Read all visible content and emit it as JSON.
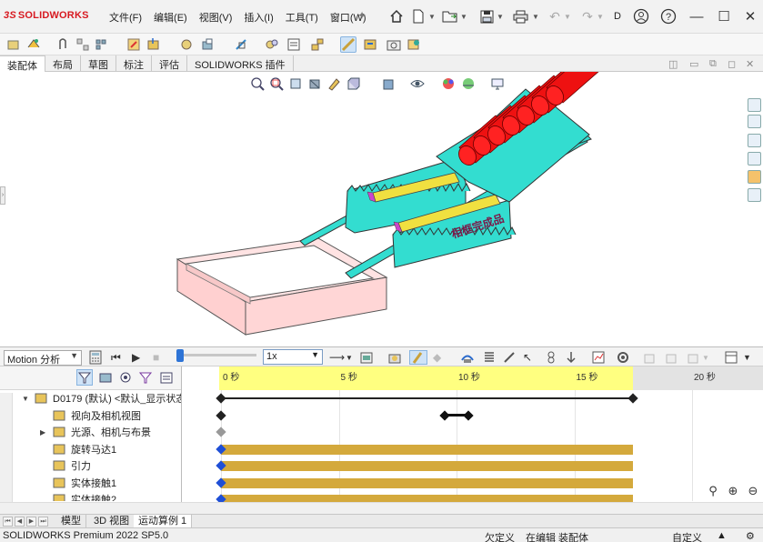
{
  "app": {
    "logo_prefix": "3S",
    "logo_text": "SOLIDWORKS",
    "user_initial": "D"
  },
  "menu": [
    "文件(F)",
    "编辑(E)",
    "视图(V)",
    "插入(I)",
    "工具(T)",
    "窗口(W)"
  ],
  "ribbon_tabs": [
    {
      "label": "装配体",
      "active": true
    },
    {
      "label": "布局",
      "active": false
    },
    {
      "label": "草图",
      "active": false
    },
    {
      "label": "标注",
      "active": false
    },
    {
      "label": "评估",
      "active": false
    },
    {
      "label": "SOLIDWORKS 插件",
      "active": false
    }
  ],
  "viewport": {
    "model_label": "相框完成品",
    "colors": {
      "rack": "#33ddd0",
      "rollers": "#ee1111",
      "tray": "#ffd6d6",
      "slot": "#f0e040",
      "slot_edge": "#cc44cc"
    }
  },
  "motion_toolbar": {
    "study_type": "Motion 分析",
    "playback_speed": "1x"
  },
  "tree": [
    {
      "label": "D0179 (默认) <默认_显示状态",
      "icon": "assembly-icon",
      "level": 0,
      "expander": "expanded"
    },
    {
      "label": "视向及相机视图",
      "icon": "camera-view-icon",
      "level": 1,
      "expander": "none"
    },
    {
      "label": "光源、相机与布景",
      "icon": "lights-scene-icon",
      "level": 1,
      "expander": "collapsed"
    },
    {
      "label": "旋转马达1",
      "icon": "rotary-motor-icon",
      "level": 1,
      "expander": "none"
    },
    {
      "label": "引力",
      "icon": "gravity-icon",
      "level": 1,
      "expander": "none"
    },
    {
      "label": "实体接触1",
      "icon": "solid-contact-icon",
      "level": 1,
      "expander": "none"
    },
    {
      "label": "实体接触2",
      "icon": "solid-contact-icon",
      "level": 1,
      "expander": "none"
    }
  ],
  "timeline": {
    "ticks": [
      {
        "label": "0 秒",
        "t": 0
      },
      {
        "label": "5 秒",
        "t": 5
      },
      {
        "label": "10 秒",
        "t": 10
      },
      {
        "label": "15 秒",
        "t": 15
      },
      {
        "label": "20 秒",
        "t": 20
      }
    ],
    "study_end": 17.5,
    "key_start": 0,
    "key_end": 17.5,
    "time_marker": [
      9.5,
      10.5
    ],
    "colors": {
      "active_ruler": "#ffff80",
      "bars": "#d4a93c",
      "key": "#222222",
      "key_blue": "#1f4fd6"
    }
  },
  "bottom_tabs": [
    {
      "label": "模型",
      "active": false
    },
    {
      "label": "3D 视图",
      "active": false
    },
    {
      "label": "运动算例 1",
      "active": true
    }
  ],
  "status": {
    "product": "SOLIDWORKS Premium 2022 SP5.0",
    "definition": "欠定义",
    "editing": "在编辑 装配体",
    "custom": "自定义"
  }
}
